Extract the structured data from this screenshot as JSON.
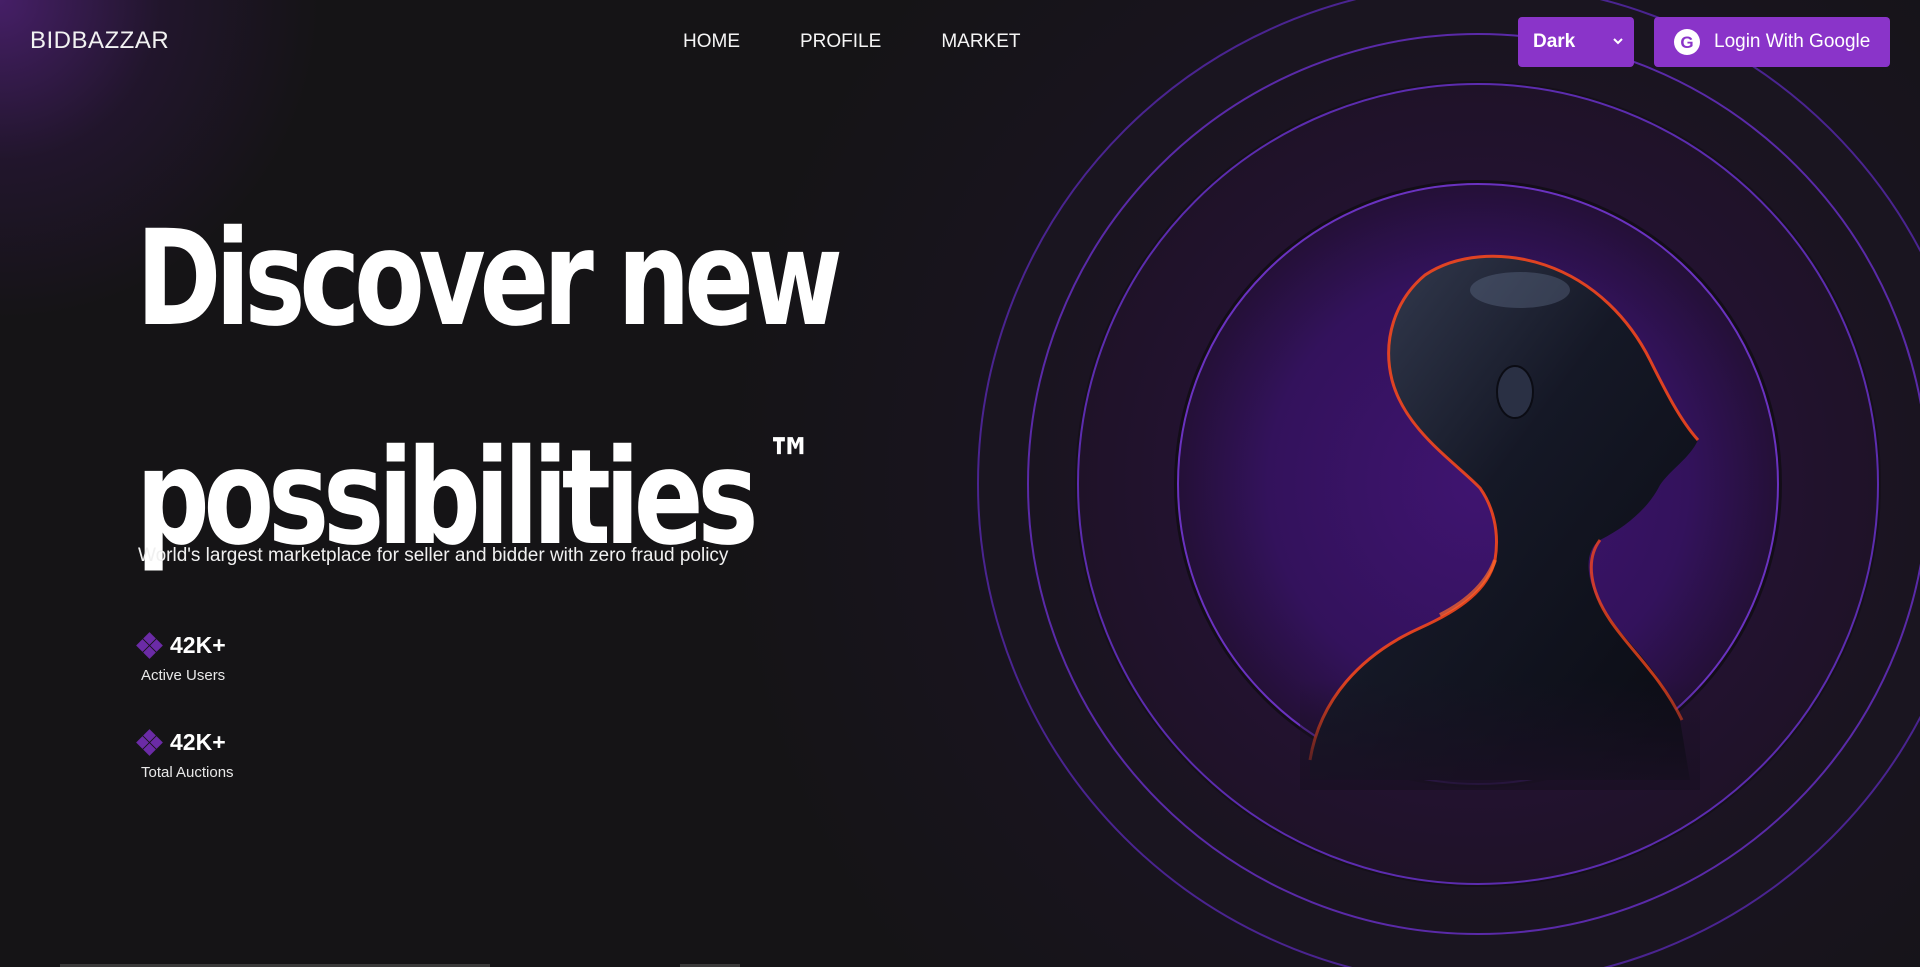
{
  "header": {
    "brand": "BIDBAZZAR",
    "nav": [
      "HOME",
      "PROFILE",
      "MARKET"
    ],
    "theme_select": {
      "selected": "Dark"
    },
    "login_button": "Login With Google"
  },
  "hero": {
    "title_line1": "Discover new",
    "title_line2": "possibilities",
    "trademark": "™",
    "tagline": "World's largest marketplace for seller and bidder with zero fraud policy"
  },
  "stats": [
    {
      "value": "42K+",
      "label": "Active Users"
    },
    {
      "value": "42K+",
      "label": "Total Auctions"
    }
  ],
  "colors": {
    "accent": "#8a34c9",
    "background": "#151416",
    "ring": "#6b2fb3",
    "glow": "#ff4a1c"
  },
  "icons": {
    "google": "google-icon",
    "stat": "diamond-icon",
    "select": "chevron-down-icon"
  }
}
